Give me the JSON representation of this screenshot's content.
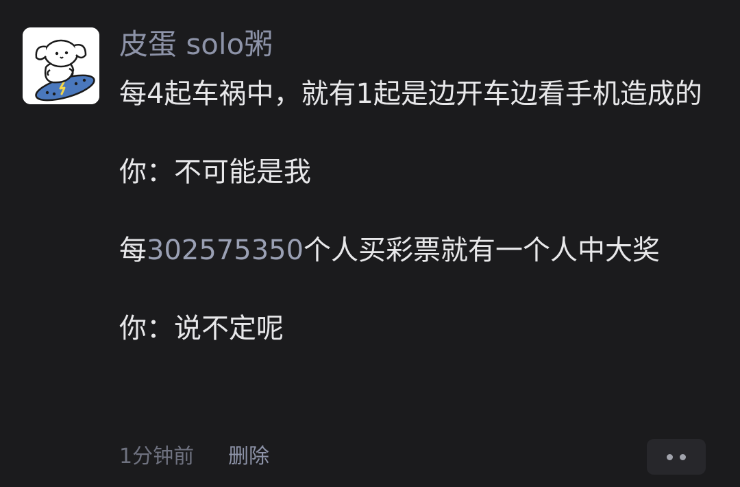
{
  "post": {
    "username": "皮蛋 solo粥",
    "avatar_icon": "puppy-on-skateboard-icon",
    "lines": {
      "l1": "每4起车祸中，就有1起是边开车边看手机造成的",
      "l2": "你：不可能是我",
      "l3_prefix": "每",
      "l3_number": "302575350",
      "l3_suffix": "个人买彩票就有一个人中大奖",
      "l4": "你：说不定呢"
    },
    "time": "1分钟前",
    "delete_label": "删除",
    "more_icon": "more-dots-icon"
  },
  "colors": {
    "background": "#1b1b1d",
    "text": "#e8e8ea",
    "username": "#8d93a8",
    "number_highlight": "#9aa0b4",
    "meta": "#6f7280"
  }
}
